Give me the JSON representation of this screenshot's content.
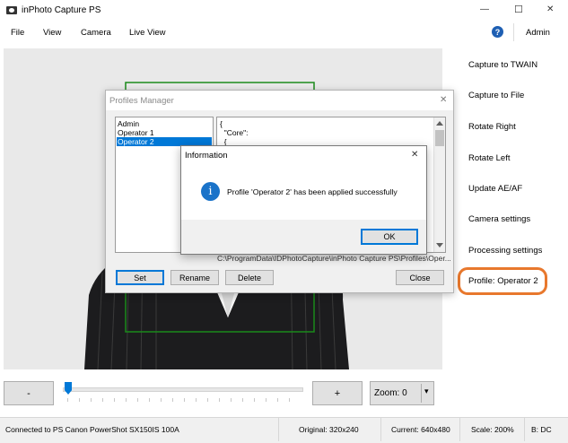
{
  "window": {
    "title": "inPhoto Capture PS",
    "controls": {
      "minimize": "—",
      "maximize": "☐",
      "close": "✕"
    }
  },
  "menu": {
    "items": [
      "File",
      "View",
      "Camera",
      "Live View"
    ],
    "help": "?",
    "user": "Admin"
  },
  "sidebar": {
    "items": [
      "Capture to TWAIN",
      "Capture to File",
      "Rotate Right",
      "Rotate Left",
      "Update AE/AF",
      "Camera settings",
      "Processing settings",
      "Profile: Operator 2"
    ],
    "highlight_color": "#e8782d"
  },
  "bottom_bar": {
    "minus": "-",
    "plus": "+",
    "zoom": "Zoom: 0",
    "zoom_arrow": "▾",
    "slider_fraction": 0.0
  },
  "status": {
    "connection": "Connected to PS Canon PowerShot SX150IS 100A",
    "original": "Original: 320x240",
    "current": "Current: 640x480",
    "scale": "Scale: 200%",
    "b": "B: DC"
  },
  "profiles_dialog": {
    "title": "Profiles Manager",
    "close": "✕",
    "profiles": [
      "Admin",
      "Operator 1",
      "Operator 2"
    ],
    "selected_index": 2,
    "json_lines": [
      "{",
      "  \"Core\":",
      "  {"
    ],
    "path": "C:\\ProgramData\\IDPhotoCapture\\inPhoto Capture PS\\Profiles\\Oper...",
    "buttons": {
      "set": "Set",
      "rename": "Rename",
      "delete": "Delete",
      "close": "Close"
    }
  },
  "info_dialog": {
    "title": "Information",
    "close": "✕",
    "icon": "i",
    "message": "Profile 'Operator 2' has been applied successfully",
    "ok": "OK",
    "accent": "#1a73c9"
  }
}
